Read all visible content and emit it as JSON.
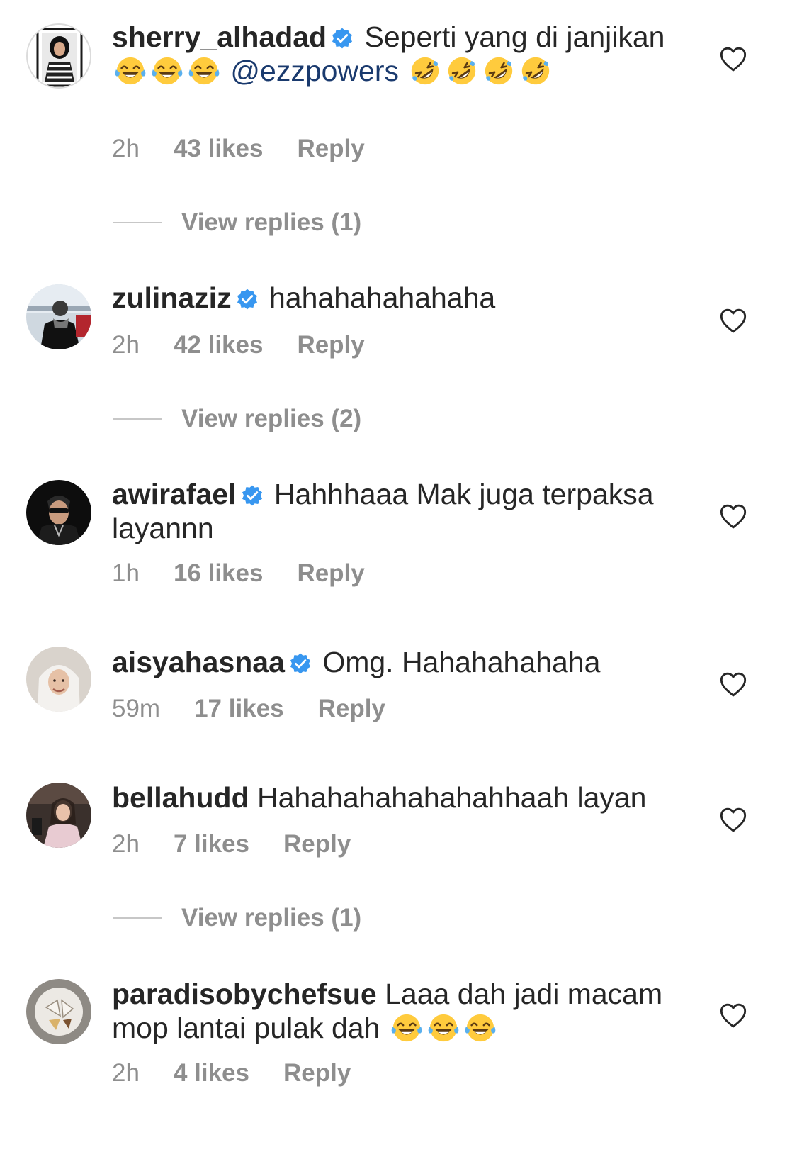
{
  "comments": [
    {
      "username": "sherry_alhadad",
      "verified": true,
      "text_before": "Seperti yang di janjikan",
      "emoji_a": "face-with-tears-of-joy",
      "mention": "@ezzpowers",
      "emoji_b": "rolling-on-floor-laughing",
      "time": "2h",
      "likes": "43 likes",
      "reply": "Reply",
      "view_replies": "View replies (1)"
    },
    {
      "username": "zulinaziz",
      "verified": true,
      "text": "hahahahahahaha",
      "time": "2h",
      "likes": "42 likes",
      "reply": "Reply",
      "view_replies": "View replies (2)"
    },
    {
      "username": "awirafael",
      "verified": true,
      "text": "Hahhhaaa Mak juga terpaksa layannn",
      "time": "1h",
      "likes": "16 likes",
      "reply": "Reply"
    },
    {
      "username": "aisyahasnaa",
      "verified": true,
      "text": "Omg. Hahahahahaha",
      "time": "59m",
      "likes": "17 likes",
      "reply": "Reply"
    },
    {
      "username": "bellahudd",
      "verified": false,
      "text": "Hahahahahahahahhaah layan",
      "time": "2h",
      "likes": "7 likes",
      "reply": "Reply",
      "view_replies": "View replies (1)"
    },
    {
      "username": "paradisobychefsue",
      "verified": false,
      "text": "Laaa dah jadi macam mop lantai pulak dah",
      "emoji": "face-with-tears-of-joy",
      "time": "2h",
      "likes": "4 likes",
      "reply": "Reply"
    }
  ],
  "colors": {
    "text": "#262626",
    "secondary": "#8e8e8e",
    "verified_blue": "#3897f0",
    "mention": "#1a3a6e"
  }
}
